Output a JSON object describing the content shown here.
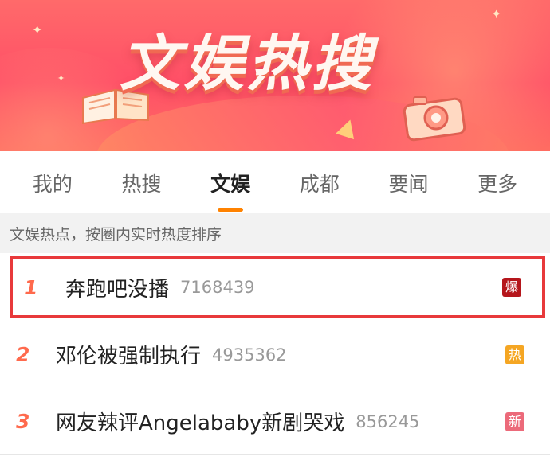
{
  "banner": {
    "title": "文娱热搜"
  },
  "tabs": [
    {
      "label": "我的",
      "active": false
    },
    {
      "label": "热搜",
      "active": false
    },
    {
      "label": "文娱",
      "active": true
    },
    {
      "label": "成都",
      "active": false
    },
    {
      "label": "要闻",
      "active": false
    },
    {
      "label": "更多",
      "active": false
    }
  ],
  "subhead": "文娱热点，按圈内实时热度排序",
  "items": [
    {
      "rank": "1",
      "topic": "奔跑吧没播",
      "count": "7168439",
      "badge": "爆",
      "badge_color": "#b5161c",
      "highlighted": true
    },
    {
      "rank": "2",
      "topic": "邓伦被强制执行",
      "count": "4935362",
      "badge": "热",
      "badge_color": "#f5a623",
      "highlighted": false
    },
    {
      "rank": "3",
      "topic": "网友辣评Angelababy新剧哭戏",
      "count": "856245",
      "badge": "新",
      "badge_color": "#ec6a7a",
      "highlighted": false
    }
  ],
  "colors": {
    "accent": "#ff8200",
    "rank": "#ff6a4d",
    "highlight_border": "#e8393b"
  }
}
